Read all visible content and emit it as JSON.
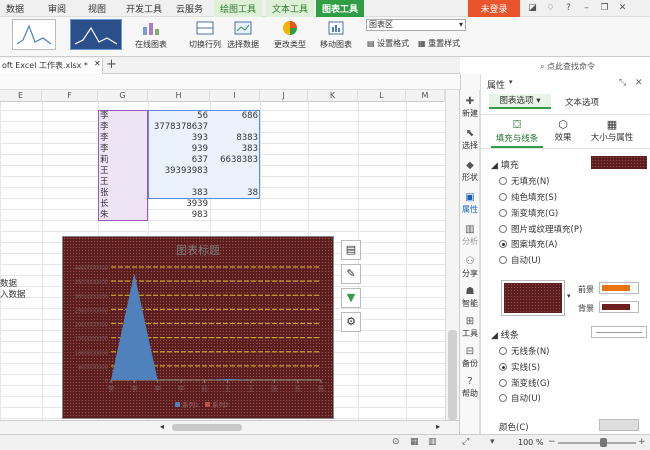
{
  "menu": {
    "items": [
      "数据",
      "审阅",
      "视图",
      "开发工具",
      "云服务",
      "绘图工具",
      "文本工具",
      "图表工具"
    ],
    "login": "未登录"
  },
  "ribbon": {
    "online_chart": "在线图表",
    "switch_rowcol": "切换行列",
    "select_data": "选择数据",
    "change_type": "更改类型",
    "move_chart": "移动图表",
    "chart_area": "图表区",
    "set_format": "设置格式",
    "reset_style": "重置样式",
    "search_label": "点此查找命令"
  },
  "doc": {
    "tab": "oft Excel 工作表.xlsx *"
  },
  "grid": {
    "columns": [
      "E",
      "F",
      "G",
      "H",
      "I",
      "J",
      "K",
      "L",
      "M"
    ],
    "g_values": [
      "李",
      "李",
      "李",
      "李",
      "莉",
      "王",
      "王",
      "张",
      "长",
      "朱"
    ],
    "h_values": [
      "56",
      "3778378637",
      "393",
      "939",
      "637",
      "39393983",
      "",
      "383",
      "3939",
      "983"
    ],
    "i_values": [
      "686",
      "",
      "8383",
      "383",
      "6638383",
      "",
      "",
      "38",
      "",
      ""
    ],
    "left_text": [
      "数据",
      "入数据"
    ]
  },
  "chart_data": {
    "type": "area",
    "title": "图表标题",
    "categories": [
      "李",
      "李",
      "李",
      "李",
      "莉",
      "王",
      "王",
      "张",
      "长",
      "朱"
    ],
    "series": [
      {
        "name": "系列1",
        "values": [
          56,
          3778378637,
          393,
          939,
          637,
          39393983,
          0,
          383,
          3939,
          983
        ]
      },
      {
        "name": "系列2",
        "values": [
          686,
          0,
          8383,
          383,
          6638383,
          0,
          0,
          38,
          0,
          0
        ]
      }
    ],
    "y_ticks": [
      "4000000000",
      "3500000000",
      "3000000000",
      "2500000000",
      "2000000000",
      "1500000000",
      "1000000000",
      "500000000",
      "0"
    ],
    "ylim": [
      0,
      4000000000
    ],
    "colors": {
      "series1": "#4f81bd",
      "series2": "#c0504d",
      "grid": "#c8a020",
      "bg": "#5a1e1e"
    }
  },
  "status": {
    "zoom": "100 %"
  },
  "panel": {
    "title": "属性",
    "tabs": [
      "图表选项",
      "文本选项"
    ],
    "subtabs": [
      "填充与线条",
      "效果",
      "大小与属性"
    ],
    "fill_header": "填充",
    "fill_options": [
      "无填充(N)",
      "纯色填充(S)",
      "渐变填充(G)",
      "图片或纹理填充(P)",
      "图案填充(A)",
      "自动(U)"
    ],
    "fill_selected": 4,
    "foreground": "前景",
    "background": "背景",
    "line_header": "线条",
    "line_options": [
      "无线条(N)",
      "实线(S)",
      "渐变线(G)",
      "自动(U)"
    ],
    "line_selected": 1,
    "color_label": "颜色(C)",
    "fg_color": "#e87511",
    "bg_color": "#6b1f1f"
  },
  "sidebar": {
    "items": [
      "新建",
      "选择",
      "形状",
      "属性",
      "分析",
      "分享",
      "智能",
      "工具",
      "备份",
      "帮助"
    ]
  }
}
